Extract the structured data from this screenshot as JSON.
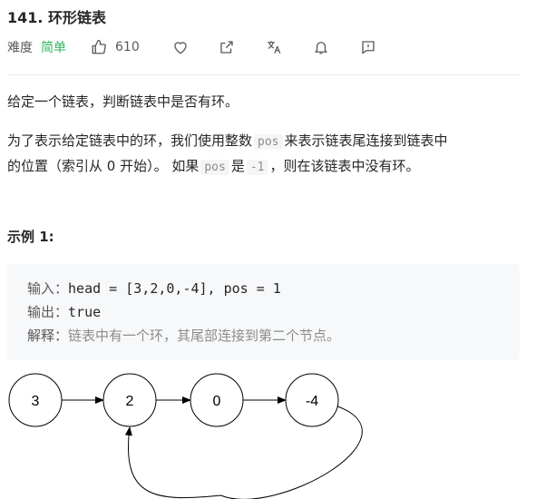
{
  "problem": {
    "title": "141. 环形链表"
  },
  "meta": {
    "difficulty_label": "难度",
    "difficulty": "简单",
    "likes": "610",
    "accent_color": "#2db55d",
    "icons": [
      "thumbs-up-icon",
      "heart-icon",
      "share-icon",
      "translate-icon",
      "bell-icon",
      "feedback-icon"
    ]
  },
  "description": {
    "p1": "给定一个链表，判断链表中是否有环。",
    "p2_a": "为了表示给定链表中的环，我们使用整数",
    "p2_code1": "pos",
    "p2_b": "来表示链表尾连接到链表中",
    "p2_c": "的位置（索引从 0 开始）。 如果",
    "p2_code2": "pos",
    "p2_d": "是",
    "p2_code3": "-1",
    "p2_e": "，则在该链表中没有环。"
  },
  "example": {
    "heading": "示例 1:",
    "input_label": "输入：",
    "input_value": "head = [3,2,0,-4], pos = 1",
    "output_label": "输出：",
    "output_value": "true",
    "explain_label": "解释：",
    "explain_value": "链表中有一个环，其尾部连接到第二个节点。"
  },
  "diagram": {
    "nodes": [
      "3",
      "2",
      "0",
      "-4"
    ],
    "cycle_from_index": 3,
    "cycle_to_index": 1
  }
}
